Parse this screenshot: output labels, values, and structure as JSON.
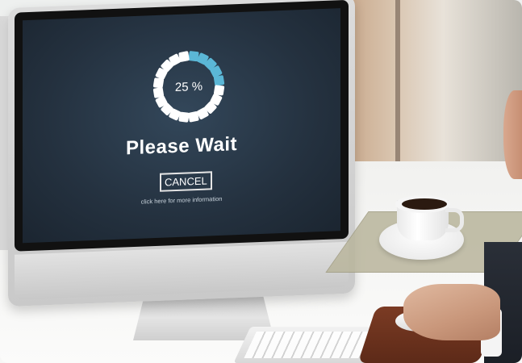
{
  "screen": {
    "progress_text": "25 %",
    "progress_fraction": 0.25,
    "title": "Please Wait",
    "cancel_label": "CANCEL",
    "info_text": "click here for more information",
    "spinner_segments": 20,
    "colors": {
      "screen_bg": "#24313f",
      "active_segment": "#5bb7d6",
      "inactive_segment": "#ffffff"
    }
  }
}
